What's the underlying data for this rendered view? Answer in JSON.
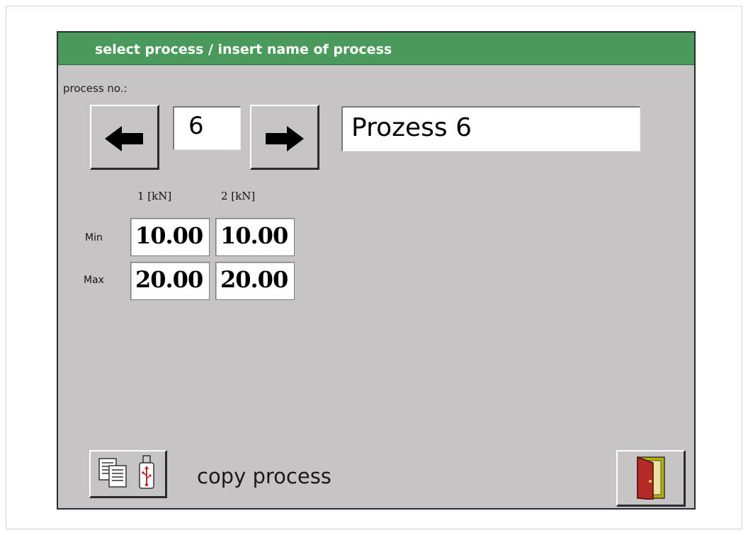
{
  "titlebar": {
    "title": "select process / insert name of process"
  },
  "process": {
    "number_label": "process no.:",
    "number": "6",
    "name": "Prozess 6"
  },
  "limits": {
    "columns": [
      "1 [kN]",
      "2 [kN]"
    ],
    "rows": [
      {
        "label": "Min",
        "values": [
          "10.00",
          "10.00"
        ]
      },
      {
        "label": "Max",
        "values": [
          "20.00",
          "20.00"
        ]
      }
    ]
  },
  "footer": {
    "copy_label": "copy process"
  },
  "icons": {
    "prev": "arrow-left-icon",
    "next": "arrow-right-icon",
    "copy": "copy-to-usb-icon",
    "exit": "exit-door-icon"
  },
  "colors": {
    "titlebar": "#4a9a5c",
    "panel": "#c6c4c4"
  }
}
